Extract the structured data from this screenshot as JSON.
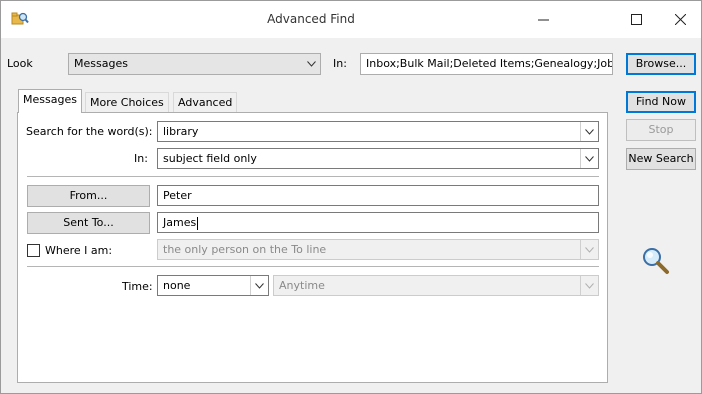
{
  "window": {
    "title": "Advanced Find",
    "app_icon": "search-folders-icon",
    "minimize_icon": "minimize-icon",
    "maximize_icon": "maximize-icon",
    "close_icon": "close-icon"
  },
  "look": {
    "label": "Look",
    "value": "Messages",
    "in_label": "In:",
    "in_value": "Inbox;Bulk Mail;Deleted Items;Genealogy;Job"
  },
  "buttons": {
    "browse": "Browse...",
    "find_now": "Find Now",
    "stop": "Stop",
    "new_search": "New Search"
  },
  "tabs": [
    {
      "label": "Messages",
      "active": true
    },
    {
      "label": "More Choices",
      "active": false
    },
    {
      "label": "Advanced",
      "active": false
    }
  ],
  "form": {
    "search_words_label": "Search for the word(s):",
    "search_words_value": "library",
    "in_label": "In:",
    "in_value": "subject field only",
    "from_button": "From...",
    "from_value": "Peter",
    "sent_to_button": "Sent To...",
    "sent_to_value": "James",
    "where_label": "Where I am:",
    "where_checked": false,
    "where_value": "the only person on the To line",
    "time_label": "Time:",
    "time_value": "none",
    "time_range_value": "Anytime"
  },
  "decor": {
    "magnifier_icon": "magnifier-icon"
  }
}
